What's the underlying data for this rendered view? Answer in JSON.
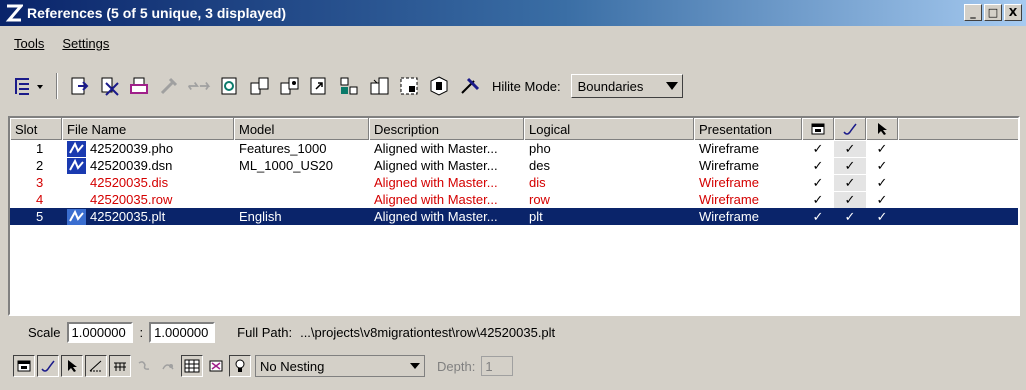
{
  "window": {
    "title": "References (5 of 5 unique, 3 displayed)",
    "minimize": "_",
    "maximize": "□",
    "close": "X"
  },
  "menu": [
    {
      "label": "Tools"
    },
    {
      "label": "Settings"
    }
  ],
  "toolbar": {
    "icons": [
      "tree-view-icon",
      "attach-icon",
      "detach-icon",
      "print-icon",
      "tools-icon",
      "move-icon",
      "reload-icon",
      "copy-icon",
      "scale-icon",
      "rotate-icon",
      "mirror-icon",
      "clip-icon",
      "mask-icon",
      "clip-delete-icon",
      "settings-icon"
    ],
    "hilite_label": "Hilite Mode:",
    "hilite_value": "Boundaries"
  },
  "table": {
    "columns": {
      "slot": "Slot",
      "file": "File Name",
      "model": "Model",
      "desc": "Description",
      "logical": "Logical",
      "presentation": "Presentation"
    },
    "rows": [
      {
        "slot": "1",
        "file": "42520039.pho",
        "model": "Features_1000",
        "desc": "Aligned with Master...",
        "logical": "pho",
        "presentation": "Wireframe",
        "c1": "✓",
        "c2": "✓",
        "c3": "✓"
      },
      {
        "slot": "2",
        "file": "42520039.dsn",
        "model": "ML_1000_US20",
        "desc": "Aligned with Master...",
        "logical": "des",
        "presentation": "Wireframe",
        "c1": "✓",
        "c2": "✓",
        "c3": "✓"
      },
      {
        "slot": "3",
        "file": "42520035.dis",
        "model": "",
        "desc": "Aligned with Master...",
        "logical": "dis",
        "presentation": "Wireframe",
        "c1": "✓",
        "c2": "✓",
        "c3": "✓"
      },
      {
        "slot": "4",
        "file": "42520035.row",
        "model": "",
        "desc": "Aligned with Master...",
        "logical": "row",
        "presentation": "Wireframe",
        "c1": "✓",
        "c2": "✓",
        "c3": "✓"
      },
      {
        "slot": "5",
        "file": "42520035.plt",
        "model": "English",
        "desc": "Aligned with Master...",
        "logical": "plt",
        "presentation": "Wireframe",
        "c1": "✓",
        "c2": "✓",
        "c3": "✓"
      }
    ]
  },
  "bottom": {
    "scale_label": "Scale",
    "scale_a": "1.000000",
    "scale_sep": ":",
    "scale_b": "1.000000",
    "fullpath_label": "Full Path:",
    "fullpath_value": "...\\projects\\v8migrationtest\\row\\42520035.plt",
    "nesting_value": "No Nesting",
    "depth_label": "Depth:",
    "depth_value": "1"
  },
  "colors": {
    "title_start": "#0a246a",
    "selection": "#0a246a",
    "missing_ref_text": "#d40000",
    "window_bg": "#d4d0c8"
  }
}
